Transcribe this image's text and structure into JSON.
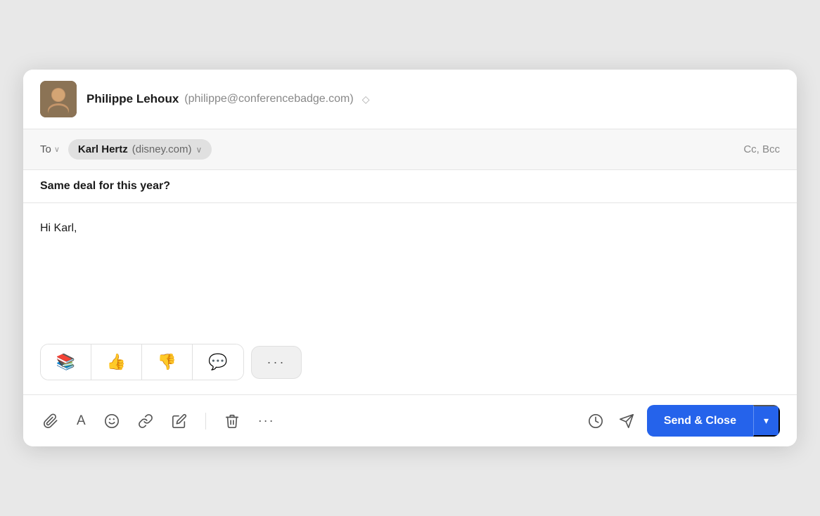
{
  "header": {
    "sender_name": "Philippe Lehoux",
    "sender_email": "(philippe@conferencebadge.com)",
    "avatar_emoji": "🧑",
    "chevron_label": "◇"
  },
  "to_row": {
    "label": "To",
    "chevron": "∨",
    "recipient_name": "Karl Hertz",
    "recipient_domain": "(disney.com)",
    "recipient_chevron": "∨",
    "cc_bcc": "Cc, Bcc"
  },
  "subject": {
    "text": "Same deal for this year?"
  },
  "body": {
    "text": "Hi Karl,"
  },
  "quick_replies": {
    "items": [
      {
        "label": "📚",
        "name": "books-emoji"
      },
      {
        "label": "👍",
        "name": "thumbsup-emoji"
      },
      {
        "label": "👎",
        "name": "thumbsdown-emoji"
      },
      {
        "label": "💬",
        "name": "chat-emoji"
      }
    ],
    "more_label": "···"
  },
  "toolbar": {
    "attach_icon": "paperclip",
    "font_icon": "A",
    "emoji_icon": "smiley",
    "link_icon": "link",
    "edit_icon": "pencil",
    "delete_icon": "trash",
    "more_icon": "···",
    "schedule_icon": "clock",
    "send_later_icon": "send",
    "send_close_label": "Send & Close",
    "dropdown_icon": "▾"
  }
}
